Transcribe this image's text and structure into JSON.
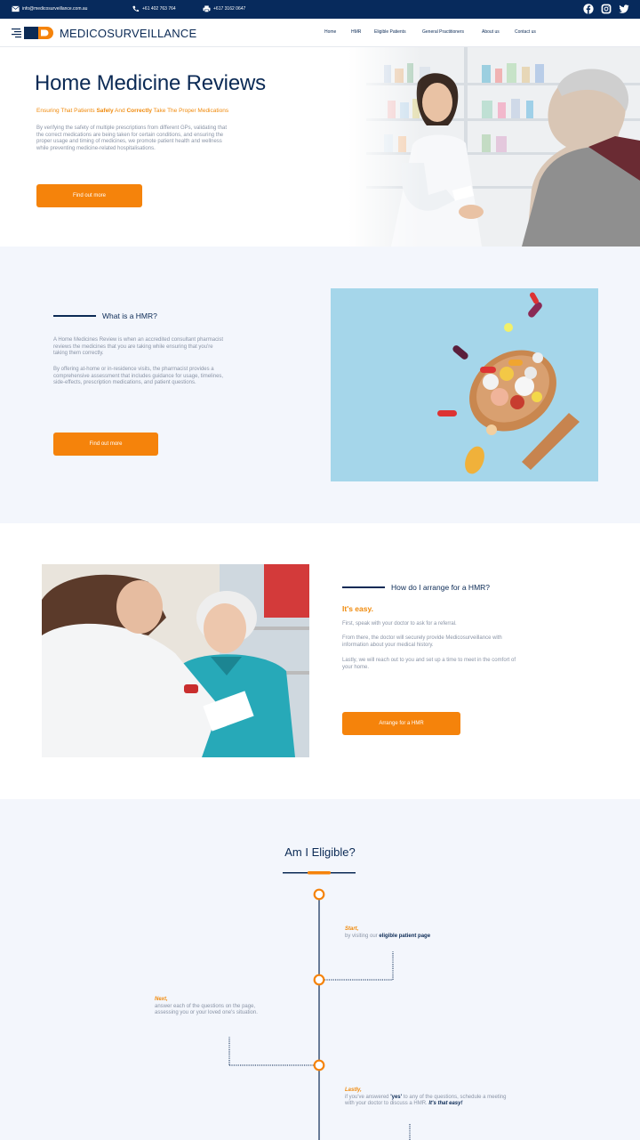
{
  "topbar": {
    "email": "info@medicosurveillance.com.au",
    "phone": "+61 402 763 764",
    "fax": "+617 3162 0647",
    "social": [
      "facebook-icon",
      "instagram-icon",
      "twitter-icon"
    ]
  },
  "header": {
    "logo_text": "MEDICOSURVEILLANCE",
    "nav": [
      "Home",
      "HMR",
      "Eligible Patients",
      "General Practitioners",
      "About us",
      "Contact us"
    ]
  },
  "hero": {
    "title": "Home Medicine Reviews",
    "tagline_1": "Ensuring That Patients ",
    "tagline_safely": "Safely",
    "tagline_2": " And ",
    "tagline_correctly": "Correctly",
    "tagline_3": " Take The Proper Medications",
    "description": "By verifying the safety of multiple prescriptions from different GPs, validating that the correct medications are being taken for certain conditions, and ensuring the proper usage and timing of medicines, we promote patient health and wellness while preventing medicine-related hospitalisations.",
    "button": "Find out more"
  },
  "what": {
    "heading": "What is a HMR?",
    "p1": "A Home Medicines Review is when an accredited consultant pharmacist reviews the medicines that you are taking while ensuring that you're taking them correctly.",
    "p2": "By offering at-home or in-residence visits, the pharmacist provides a comprehensive assessment that includes guidance for usage, timelines, side-effects, prescription medications, and patient questions.",
    "button": "Find out more"
  },
  "arrange": {
    "heading": "How do I arrange for a HMR?",
    "easy": "It's easy.",
    "p1": "First, speak with your doctor to ask for a referral.",
    "p2": "From there, the doctor will securely provide Medicosurveillance with information about your medical history.",
    "p3": "Lastly, we will reach out to you and set up a time to meet in the comfort of your home.",
    "button": "Arrange for a HMR"
  },
  "eligible": {
    "title": "Am I Eligible?",
    "step1_lead": "Start,",
    "step1_text": "by visiting our ",
    "step1_link": "eligible patient page",
    "step2_lead": "Next,",
    "step2_text": "answer each of the questions on the page, assessing you or your loved one's situation.",
    "step3_lead": "Lastly,",
    "step3_text_1": "if you've answered ",
    "step3_yes": "'yes'",
    "step3_text_2": " to any of the questions, schedule a meeting with your doctor to discuss a HMR. ",
    "step3_easy": "It's that easy!"
  },
  "colors": {
    "navy": "#072a5c",
    "orange": "#f5830b",
    "light_bg": "#f3f6fc"
  }
}
